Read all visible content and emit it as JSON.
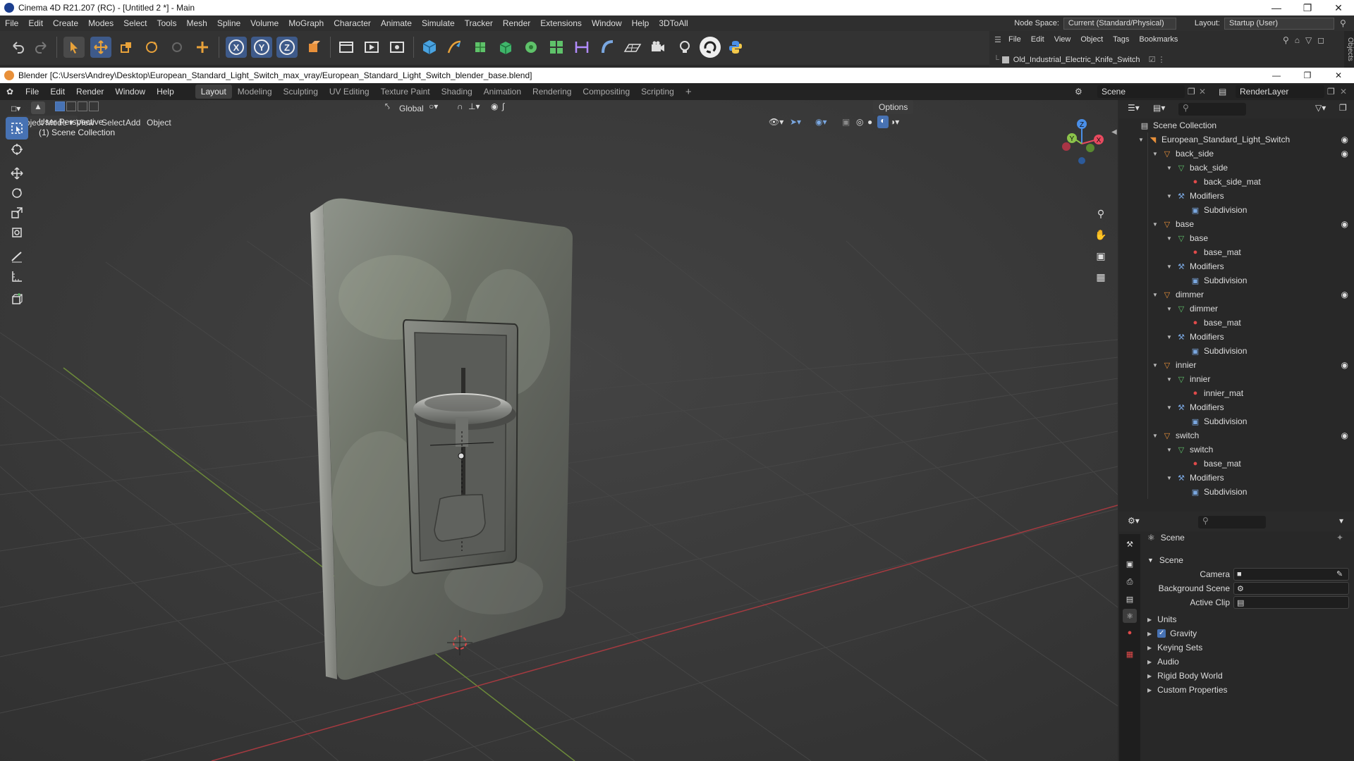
{
  "c4d": {
    "title": "Cinema 4D R21.207 (RC) - [Untitled 2 *] - Main",
    "menu": [
      "File",
      "Edit",
      "Create",
      "Modes",
      "Select",
      "Tools",
      "Mesh",
      "Spline",
      "Volume",
      "MoGraph",
      "Character",
      "Animate",
      "Simulate",
      "Tracker",
      "Render",
      "Extensions",
      "Window",
      "Help",
      "3DToAll"
    ],
    "node_space_label": "Node Space:",
    "node_space_value": "Current (Standard/Physical)",
    "layout_label": "Layout:",
    "layout_value": "Startup (User)",
    "objmgr_menu": [
      "File",
      "Edit",
      "View",
      "Object",
      "Tags",
      "Bookmarks"
    ],
    "objmgr_item": "Old_Industrial_Electric_Knife_Switch",
    "side_label": "Objects",
    "toolbar_icons": [
      "undo-icon",
      "redo-icon",
      "select-icon",
      "move-icon",
      "scale-icon",
      "rotate-icon",
      "live-select-icon",
      "add-icon",
      "x-axis-icon",
      "y-axis-icon",
      "z-axis-icon",
      "coordinate-system-icon",
      "render-region-icon",
      "render-view-icon",
      "render-settings-icon",
      "cube-icon",
      "pen-icon",
      "subdivision-icon",
      "extrude-icon",
      "cloner-icon",
      "array-icon",
      "deformer-icon",
      "bend-icon",
      "floor-icon",
      "camera-icon",
      "light-icon",
      "cycle-icon",
      "python-icon"
    ]
  },
  "blender": {
    "title": "Blender [C:\\Users\\Andrey\\Desktop\\European_Standard_Light_Switch_max_vray/European_Standard_Light_Switch_blender_base.blend]",
    "menu": [
      "File",
      "Edit",
      "Render",
      "Window",
      "Help"
    ],
    "workspaces": [
      "Layout",
      "Modeling",
      "Sculpting",
      "UV Editing",
      "Texture Paint",
      "Shading",
      "Animation",
      "Rendering",
      "Compositing",
      "Scripting"
    ],
    "active_workspace": "Layout",
    "scene_field": "Scene",
    "renderlayer_field": "RenderLayer",
    "viewport": {
      "mode": "Object Mode",
      "menus": [
        "View",
        "Select",
        "Add",
        "Object"
      ],
      "transform_orientation": "Global",
      "options": "Options",
      "perspective_label": "User Perspective",
      "collection_label": "(1) Scene Collection",
      "gizmo_axes": {
        "x": "X",
        "y": "Y",
        "z": "Z"
      }
    },
    "outliner": {
      "root": "Scene Collection",
      "rows": [
        {
          "label": "European_Standard_Light_Switch",
          "depth": 1,
          "icon": "empty",
          "eye": true,
          "expanded": true
        },
        {
          "label": "back_side",
          "depth": 2,
          "icon": "object",
          "eye": true,
          "expanded": true
        },
        {
          "label": "back_side",
          "depth": 3,
          "icon": "mesh",
          "eye": false,
          "expanded": true
        },
        {
          "label": "back_side_mat",
          "depth": 4,
          "icon": "material",
          "eye": false,
          "expanded": false
        },
        {
          "label": "Modifiers",
          "depth": 3,
          "icon": "wrench",
          "eye": false,
          "expanded": true
        },
        {
          "label": "Subdivision",
          "depth": 4,
          "icon": "modifier",
          "eye": false,
          "expanded": false
        },
        {
          "label": "base",
          "depth": 2,
          "icon": "object",
          "eye": true,
          "expanded": true
        },
        {
          "label": "base",
          "depth": 3,
          "icon": "mesh",
          "eye": false,
          "expanded": true
        },
        {
          "label": "base_mat",
          "depth": 4,
          "icon": "material",
          "eye": false,
          "expanded": false
        },
        {
          "label": "Modifiers",
          "depth": 3,
          "icon": "wrench",
          "eye": false,
          "expanded": true
        },
        {
          "label": "Subdivision",
          "depth": 4,
          "icon": "modifier",
          "eye": false,
          "expanded": false
        },
        {
          "label": "dimmer",
          "depth": 2,
          "icon": "object",
          "eye": true,
          "expanded": true
        },
        {
          "label": "dimmer",
          "depth": 3,
          "icon": "mesh",
          "eye": false,
          "expanded": true
        },
        {
          "label": "base_mat",
          "depth": 4,
          "icon": "material",
          "eye": false,
          "expanded": false
        },
        {
          "label": "Modifiers",
          "depth": 3,
          "icon": "wrench",
          "eye": false,
          "expanded": true
        },
        {
          "label": "Subdivision",
          "depth": 4,
          "icon": "modifier",
          "eye": false,
          "expanded": false
        },
        {
          "label": "innier",
          "depth": 2,
          "icon": "object",
          "eye": true,
          "expanded": true
        },
        {
          "label": "innier",
          "depth": 3,
          "icon": "mesh",
          "eye": false,
          "expanded": true
        },
        {
          "label": "innier_mat",
          "depth": 4,
          "icon": "material",
          "eye": false,
          "expanded": false
        },
        {
          "label": "Modifiers",
          "depth": 3,
          "icon": "wrench",
          "eye": false,
          "expanded": true
        },
        {
          "label": "Subdivision",
          "depth": 4,
          "icon": "modifier",
          "eye": false,
          "expanded": false
        },
        {
          "label": "switch",
          "depth": 2,
          "icon": "object",
          "eye": true,
          "expanded": true
        },
        {
          "label": "switch",
          "depth": 3,
          "icon": "mesh",
          "eye": false,
          "expanded": true
        },
        {
          "label": "base_mat",
          "depth": 4,
          "icon": "material",
          "eye": false,
          "expanded": false
        },
        {
          "label": "Modifiers",
          "depth": 3,
          "icon": "wrench",
          "eye": false,
          "expanded": true
        },
        {
          "label": "Subdivision",
          "depth": 4,
          "icon": "modifier",
          "eye": false,
          "expanded": false
        }
      ]
    },
    "properties": {
      "context": "Scene",
      "panel": "Scene",
      "fields": [
        {
          "label": "Camera",
          "value": ""
        },
        {
          "label": "Background Scene",
          "value": ""
        },
        {
          "label": "Active Clip",
          "value": ""
        }
      ],
      "sections": [
        {
          "label": "Units",
          "checkbox": false
        },
        {
          "label": "Gravity",
          "checkbox": true
        },
        {
          "label": "Keying Sets",
          "checkbox": false
        },
        {
          "label": "Audio",
          "checkbox": false
        },
        {
          "label": "Rigid Body World",
          "checkbox": false
        },
        {
          "label": "Custom Properties",
          "checkbox": false
        }
      ]
    }
  },
  "colors": {
    "accent_blue": "#4772b3",
    "axis_x": "#e84a5f",
    "axis_y": "#8bc34a",
    "axis_z": "#4a8fe8",
    "object_orange": "#e8903a",
    "mesh_green": "#5fc26a",
    "material_red": "#e04a4a",
    "modifier_blue": "#7aa7e0"
  }
}
